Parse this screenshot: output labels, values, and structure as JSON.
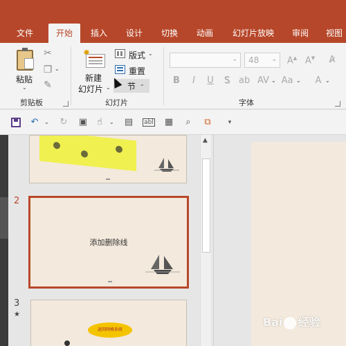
{
  "tabs": [
    "文件",
    "开始",
    "插入",
    "设计",
    "切换",
    "动画",
    "幻灯片放映",
    "审阅",
    "视图"
  ],
  "ribbon": {
    "clipboard": {
      "paste_label": "粘贴",
      "group_label": "剪贴板"
    },
    "slides": {
      "new_slide_line1": "新建",
      "new_slide_line2": "幻灯片",
      "layout_label": "版式",
      "reset_label": "重置",
      "section_label": "节",
      "group_label": "幻灯片"
    },
    "font": {
      "font_name_value": "",
      "font_size_value": "48",
      "group_label": "字体",
      "buttons": [
        "B",
        "I",
        "U",
        "S",
        "A",
        "Aa",
        "A"
      ]
    }
  },
  "thumbnails": [
    {
      "number": "2",
      "title": "添加删除线"
    },
    {
      "number": "3",
      "star": "★",
      "bubble_text": "返回网格系统"
    }
  ],
  "watermark": {
    "text_left": "Bai",
    "text_right": "经验"
  },
  "colors": {
    "accent": "#b7472a",
    "slide_bg": "#f3e9dc"
  }
}
